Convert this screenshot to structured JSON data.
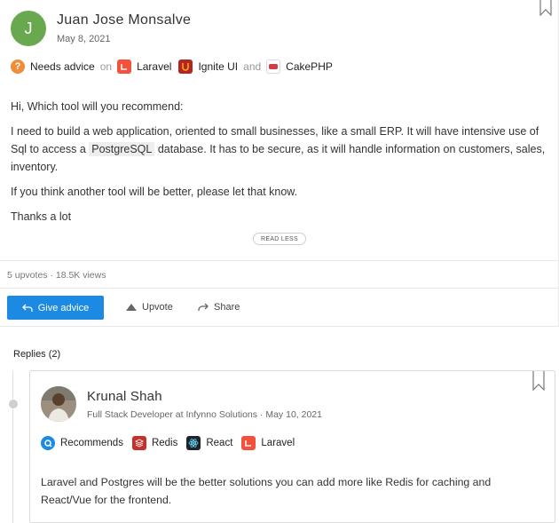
{
  "post": {
    "author_initial": "J",
    "author_name": "Juan Jose Monsalve",
    "date": "May 8, 2021",
    "tag_label": "Needs advice",
    "on_word": "on",
    "and_word": "and",
    "tools": [
      "Laravel",
      "Ignite UI",
      "CakePHP"
    ],
    "paragraphs": {
      "p1": "Hi, Which tool will you recommend:",
      "p2_before": "I need to build a web application, oriented to small businesses, like a small ERP. It will have intensive use of Sql to access a",
      "p2_code": "PostgreSQL",
      "p2_after": "database. It has to be secure, as it will handle information on customers, sales, inventory.",
      "p3": "If you think another tool will be better, please let that know.",
      "p4": "Thanks a lot"
    },
    "read_less": "READ LESS",
    "stats": "5 upvotes · 18.5K views"
  },
  "actions": {
    "give_advice": "Give advice",
    "upvote": "Upvote",
    "share": "Share"
  },
  "replies": {
    "label": "Replies",
    "count": "(2)"
  },
  "reply": {
    "author_name": "Krunal Shah",
    "meta": "Full Stack Developer at Infynno Solutions · May 10, 2021",
    "rec_label": "Recommends",
    "tools": [
      "Redis",
      "React",
      "Laravel"
    ],
    "text": "Laravel and Postgres will be the better solutions you can add more like Redis for caching and React/Vue for the frontend."
  },
  "colors": {
    "accent": "#1c8ae2",
    "avatar_green": "#6aa84f",
    "advice_orange": "#f08c3a"
  }
}
